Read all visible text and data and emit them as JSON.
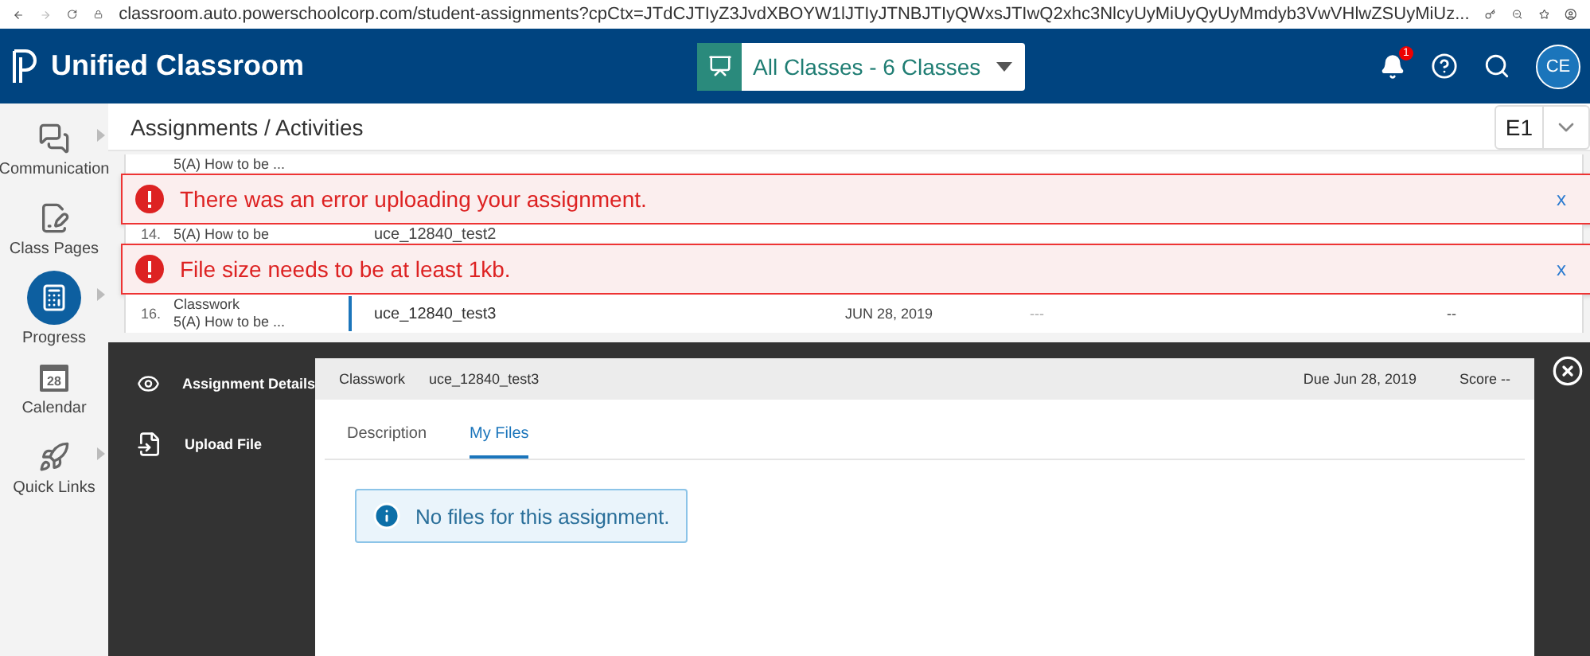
{
  "browser": {
    "url": "classroom.auto.powerschoolcorp.com/student-assignments?cpCtx=JTdCJTIyZ3JvdXBOYW1lJTIyJTNBJTIyQWxsJTIwQ2xhc3NlcyUyMiUyQyUyMmdyb3VwVHlwZSUyMiUz..."
  },
  "header": {
    "app_title": "Unified Classroom",
    "class_selector": "All Classes - 6 Classes",
    "notification_count": "1",
    "avatar_initials": "CE"
  },
  "sidebar": {
    "items": [
      {
        "label": "Communication",
        "kind": "chat",
        "selected": false,
        "has_submenu": true
      },
      {
        "label": "Class Pages",
        "kind": "pages",
        "selected": false,
        "has_submenu": false
      },
      {
        "label": "Progress",
        "kind": "progress",
        "selected": true,
        "has_submenu": true
      },
      {
        "label": "Calendar",
        "kind": "calendar",
        "selected": false,
        "has_submenu": false,
        "icon_text": "28"
      },
      {
        "label": "Quick Links",
        "kind": "rocket",
        "selected": false,
        "has_submenu": true
      }
    ]
  },
  "page": {
    "title": "Assignments / Activities",
    "term": "E1"
  },
  "table": {
    "rows": [
      {
        "kind": "partial",
        "subtitle": "5(A) How to be ..."
      },
      {
        "kind": "toast",
        "message": "There was an error uploading your assignment.",
        "close": "x"
      },
      {
        "kind": "partial",
        "number": "14.",
        "subtitle": "5(A) How to be",
        "name": "uce_12840_test2"
      },
      {
        "kind": "toast",
        "message": "File size needs to be at least 1kb.",
        "close": "x"
      },
      {
        "kind": "row",
        "number": "16.",
        "type": "Classwork",
        "subtitle": "5(A) How to be ...",
        "name": "uce_12840_test3",
        "date": "JUN 28, 2019",
        "column_5": "---",
        "column_6": "--"
      }
    ]
  },
  "details": {
    "nav": [
      {
        "label": "Assignment Details",
        "kind": "eye"
      },
      {
        "label": "Upload File",
        "kind": "upload"
      }
    ],
    "category": "Classwork",
    "name": "uce_12840_test3",
    "due_label": "Due",
    "due_date": "Jun 28, 2019",
    "score": "Score --",
    "tabs": [
      {
        "label": "Description",
        "selected": false
      },
      {
        "label": "My Files",
        "selected": true
      }
    ],
    "info": "No files for this assignment."
  }
}
